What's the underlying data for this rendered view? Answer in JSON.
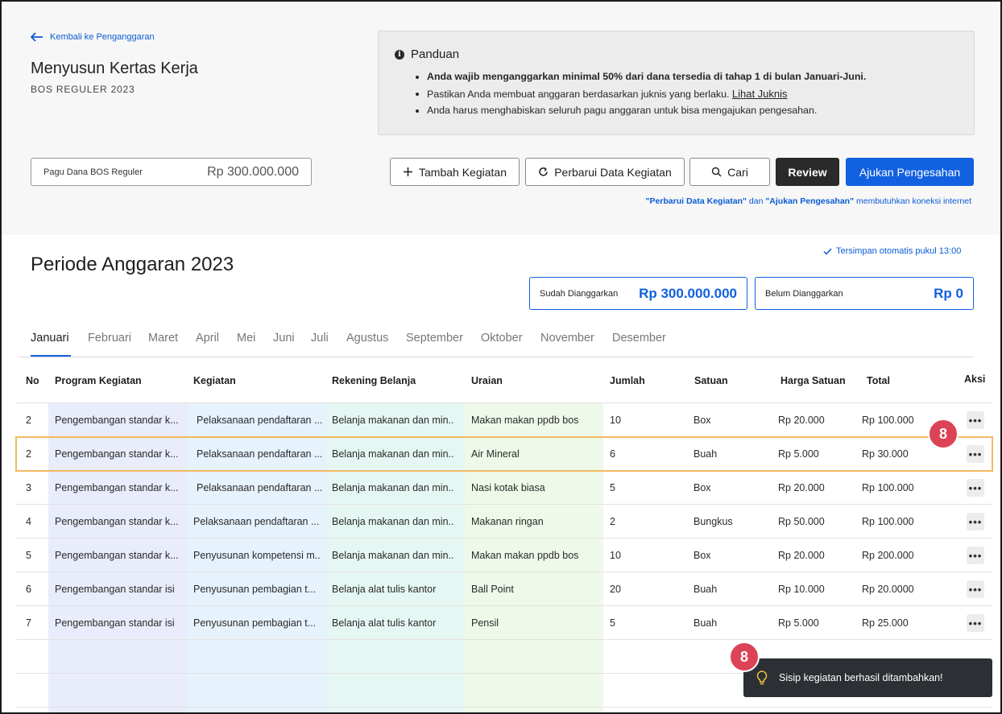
{
  "header": {
    "back_label": "Kembali ke Penganggaran",
    "title": "Menyusun Kertas Kerja",
    "subtitle": "BOS REGULER 2023"
  },
  "guide": {
    "title": "Panduan",
    "items": [
      "Anda wajib menganggarkan minimal 50% dari dana tersedia di tahap 1 di bulan Januari-Juni.",
      "Pastikan Anda membuat anggaran berdasarkan juknis yang berlaku.",
      "Anda harus menghabiskan seluruh pagu anggaran untuk bisa mengajukan pengesahan."
    ],
    "link": "Lihat Juknis"
  },
  "pagu": {
    "label": "Pagu Dana BOS Reguler",
    "value": "Rp 300.000.000"
  },
  "toolbar": {
    "add": "Tambah Kegiatan",
    "refresh": "Perbarui Data Kegiatan",
    "search": "Cari",
    "review": "Review",
    "submit": "Ajukan Pengesahan"
  },
  "note": {
    "part1": "\"Perbarui Data Kegiatan\"",
    "part2": " dan ",
    "part3": "\"Ajukan Pengesahan\"",
    "part4": " membutuhkan koneksi internet"
  },
  "periode": {
    "title": "Periode Anggaran 2023",
    "autosave": "Tersimpan otomatis pukul 13:00",
    "budgeted_label": "Sudah Dianggarkan",
    "budgeted_value": "Rp 300.000.000",
    "unbudgeted_label": "Belum Dianggarkan",
    "unbudgeted_value": "Rp 0"
  },
  "tabs": [
    "Januari",
    "Februari",
    "Maret",
    "April",
    "Mei",
    "Juni",
    "Juli",
    "Agustus",
    "September",
    "Oktober",
    "November",
    "Desember"
  ],
  "table": {
    "headers": [
      "No",
      "Program Kegiatan",
      "Kegiatan",
      "Rekening Belanja",
      "Uraian",
      "Jumlah",
      "Satuan",
      "Harga Satuan",
      "Total",
      "Aksi"
    ],
    "rows": [
      [
        "2",
        "Pengembangan standar k...",
        "Pelaksanaan pendaftaran ...",
        "Belanja makanan dan min..",
        "Makan makan ppdb bos",
        "10",
        "Box",
        "Rp 20.000",
        "Rp 100.000"
      ],
      [
        "2",
        "Pengembangan standar k...",
        "Pelaksanaan pendaftaran ...",
        "Belanja makanan dan min..",
        "Air Mineral",
        "6",
        "Buah",
        "Rp 5.000",
        "Rp 30.000"
      ],
      [
        "3",
        "Pengembangan standar k...",
        "Pelaksanaan pendaftaran ...",
        "Belanja makanan dan min..",
        "Nasi kotak biasa",
        "5",
        "Box",
        "Rp 20.000",
        "Rp 100.000"
      ],
      [
        "4",
        "Pengembangan standar k...",
        "Pelaksanaan pendaftaran ...",
        "Belanja makanan dan min..",
        "Makanan ringan",
        "2",
        "Bungkus",
        "Rp 50.000",
        "Rp 100.000"
      ],
      [
        "5",
        "Pengembangan standar k...",
        "Penyusunan kompetensi m..",
        "Belanja makanan dan min..",
        "Makan makan ppdb bos",
        "10",
        "Box",
        "Rp 20.000",
        "Rp 200.000"
      ],
      [
        "6",
        "Pengembangan standar isi",
        "Penyusunan pembagian t...",
        "Belanja alat tulis kantor",
        "Ball Point",
        "20",
        "Buah",
        "Rp 10.000",
        "Rp 20.0000"
      ],
      [
        "7",
        "Pengembangan standar isi",
        "Penyusunan pembagian t...",
        "Belanja alat tulis kantor",
        "Pensil",
        "5",
        "Buah",
        "Rp 5.000",
        "Rp 25.000"
      ]
    ],
    "more_label": "•••"
  },
  "badges": {
    "row": "8",
    "toast": "8"
  },
  "toast": {
    "message": "Sisip kegiatan berhasil ditambahkan!"
  },
  "colors": {
    "primary": "#1161e0",
    "highlight": "#f3b962",
    "badge": "#dc4356"
  }
}
